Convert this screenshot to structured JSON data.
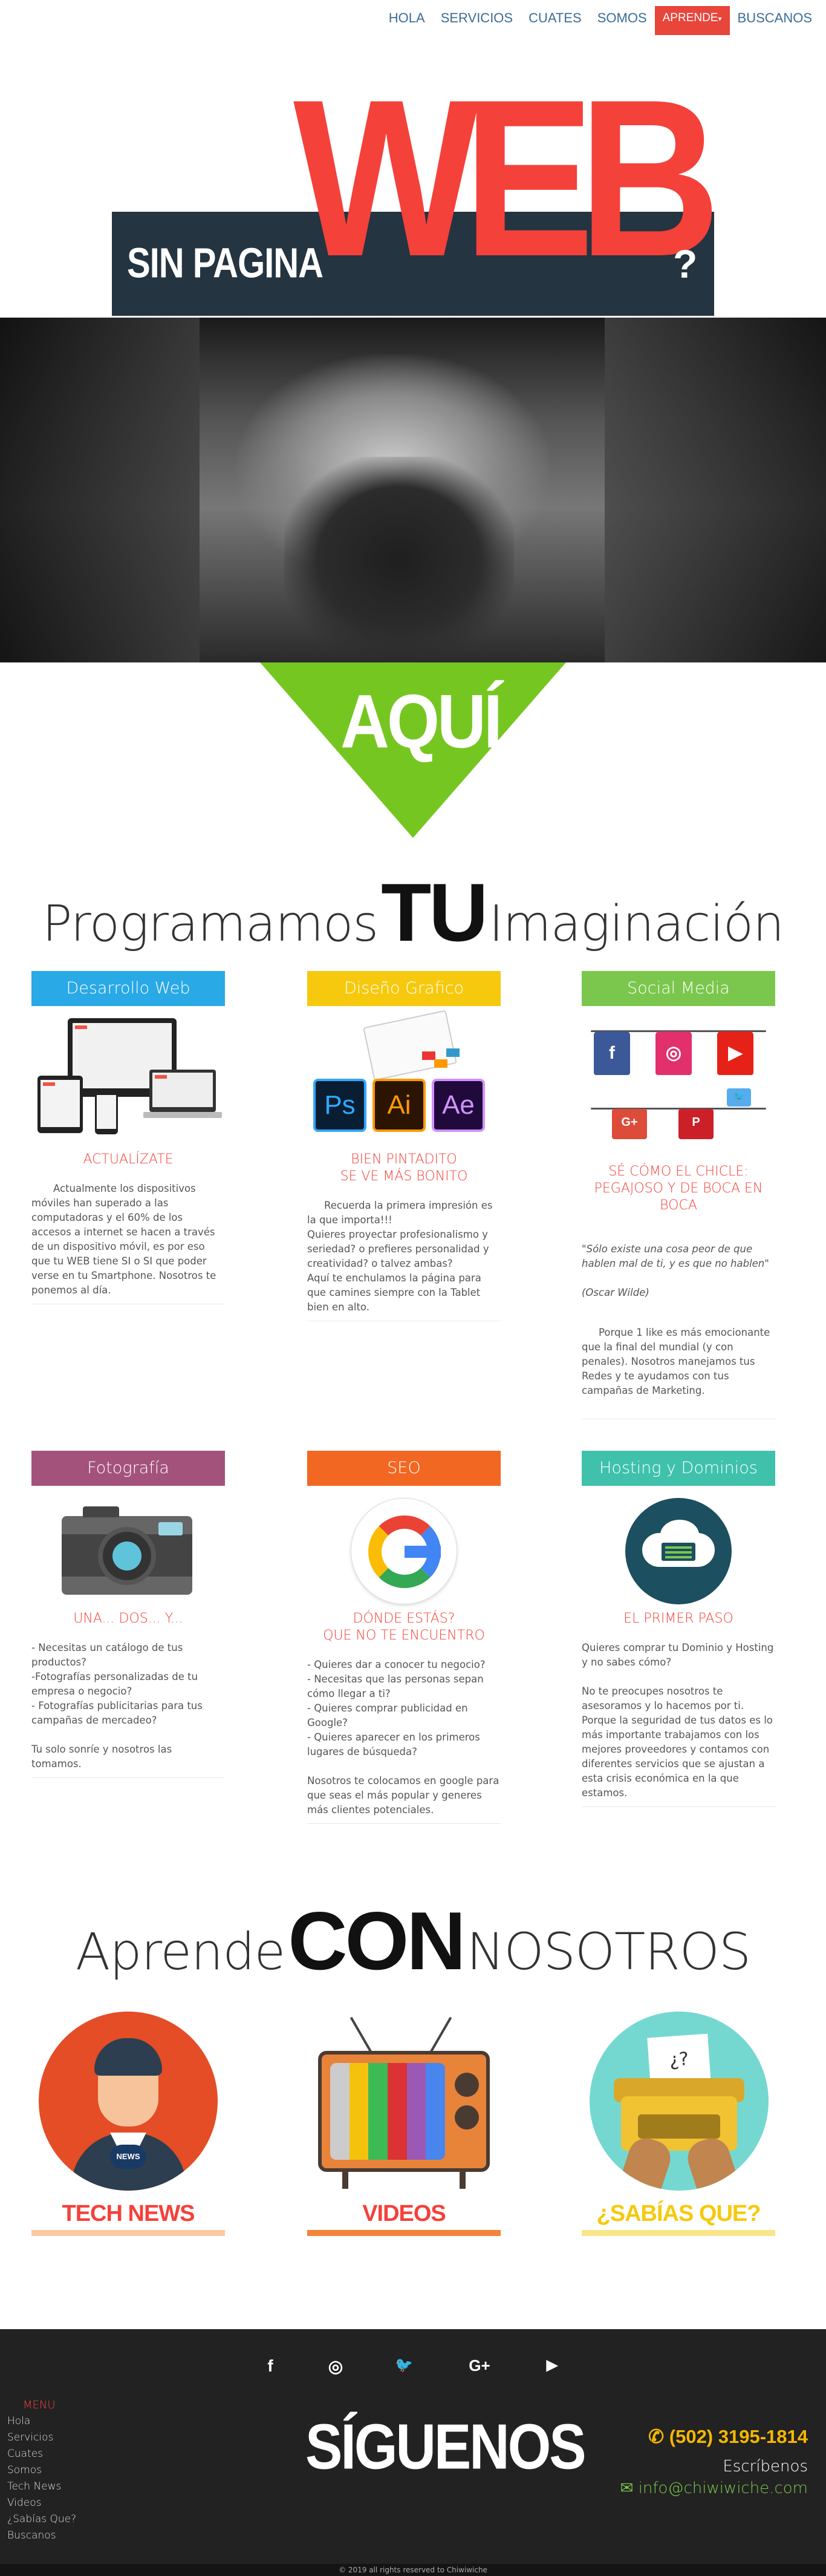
{
  "nav": {
    "items": [
      {
        "label": "HOLA"
      },
      {
        "label": "SERVICIOS"
      },
      {
        "label": "CUATES"
      },
      {
        "label": "SOMOS"
      },
      {
        "label": "APRENDE",
        "active": true
      },
      {
        "label": "BUSCANOS"
      }
    ],
    "active_color": "#e8453b",
    "link_color": "#3b6c95"
  },
  "hero": {
    "sin_pagina": "SIN PAGINA",
    "web": "WEB",
    "question": "?",
    "aqui": "AQUÍ",
    "colors": {
      "web": "#f4413a",
      "band": "#243441",
      "triangle": "#76c621"
    }
  },
  "programamos": {
    "left": "Programamos",
    "bold": "TU",
    "right": "Imaginación"
  },
  "services": [
    {
      "label": "Desarrollo Web",
      "color": "#29a9e6",
      "art": "devices-icon",
      "sub": "ACTUALÍZATE",
      "body": "Actualmente los dispositivos móviles han superado a las computadoras y el 60% de los accesos a internet se hacen a través de un dispositivo móvil, es por eso que tu WEB tiene SI o SI que poder verse en tu Smartphone. Nosotros te ponemos al día."
    },
    {
      "label": "Diseño Grafico",
      "color": "#f6c90e",
      "art": "adobe-icons",
      "sub": "BIEN PINTADITO\nSE VE MÁS BONITO",
      "body": "Recuerda la primera impresión es la que importa!!!\nQuieres proyectar profesionalismo y seriedad? o prefieres personalidad y creatividad? o talvez ambas?\nAquí te enchulamos la página para que camines siempre con la Tablet bien en alto."
    },
    {
      "label": "Social Media",
      "color": "#7bc74d",
      "art": "clothesline-icon",
      "sub": "SÉ CÓMO EL CHICLE: PEGAJOSO Y DE BOCA EN BOCA",
      "quote": "\"Sólo existe una cosa peor de que hablen mal de ti, y es que no hablen\"",
      "quote_author": "(Oscar Wilde)",
      "body": "Porque 1 like es más emocionante que la final del mundial (y con penales). Nosotros manejamos tus Redes y te ayudamos con tus campañas de Marketing."
    },
    {
      "label": "Fotografía",
      "color": "#a3527c",
      "art": "camera-icon",
      "sub": "UNA... DOS... Y...",
      "body": "- Necesitas un catálogo de tus productos?\n-Fotografías personalizadas de tu empresa o negocio?\n- Fotografías publicitarias para tus campañas de mercadeo?\n\n    Tu solo sonríe y nosotros las tomamos."
    },
    {
      "label": "SEO",
      "color": "#f26722",
      "art": "google-icon",
      "sub": "DÓNDE ESTÁS?\nQUE NO TE ENCUENTRO",
      "body": "- Quieres dar a conocer tu negocio?\n- Necesitas que las personas sepan cómo llegar a ti?\n- Quieres comprar publicidad en Google?\n- Quieres aparecer en los primeros lugares de búsqueda?\n\n    Nosotros te colocamos en google para que seas el más popular y generes más clientes potenciales."
    },
    {
      "label": "Hosting y Dominios",
      "color": "#3fc1ac",
      "art": "cloud-server-icon",
      "sub": "EL PRIMER PASO",
      "body": "Quieres comprar tu Dominio y Hosting y no sabes cómo?\n\n    No te preocupes nosotros te asesoramos y lo hacemos por ti. Porque la seguridad de tus datos es lo más importante trabajamos con los mejores proveedores y contamos con diferentes servicios que se ajustan a esta crisis económica en la que estamos."
    }
  ],
  "aprende": {
    "left": "Aprende",
    "bold": "CON",
    "right": "NOSOTROS",
    "items": [
      {
        "label": "TECH NEWS",
        "color": "#f4413a",
        "line": "#f9c9a4",
        "art": "news-anchor-icon",
        "badge": "NEWS"
      },
      {
        "label": "VIDEOS",
        "color": "#f4413a",
        "line": "#f4843a",
        "art": "retro-tv-icon"
      },
      {
        "label": "¿SABÍAS QUE?",
        "color": "#f6c90e",
        "line": "#f9e58a",
        "art": "typewriter-icon",
        "paper": "¿?"
      }
    ]
  },
  "footer": {
    "social": [
      {
        "icon": "facebook-icon",
        "glyph": "f"
      },
      {
        "icon": "instagram-icon",
        "glyph": "◎"
      },
      {
        "icon": "twitter-icon",
        "glyph": "🐦"
      },
      {
        "icon": "google-plus-icon",
        "glyph": "G+"
      },
      {
        "icon": "youtube-icon",
        "glyph": "▶"
      }
    ],
    "menu_title": "MENU",
    "menu": [
      "Hola",
      "Servicios",
      "Cuates",
      "Somos",
      "Tech News",
      "Videos",
      "¿Sabías Que?",
      "Buscanos"
    ],
    "siguenos": "SÍGUENOS",
    "phone": "(502) 3195-1814",
    "escribenos": "Escríbenos",
    "email": "info@chiwiwiche.com",
    "copyright": "© 2019 all rights reserved to Chiwiwiche"
  }
}
